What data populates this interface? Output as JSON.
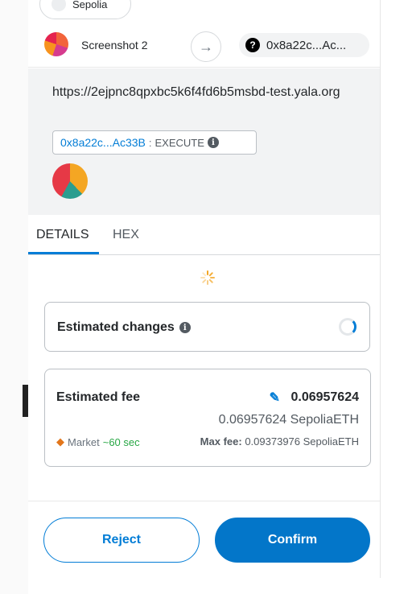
{
  "network": {
    "label": "Sepolia"
  },
  "header": {
    "from_account": "Screenshot 2",
    "to_address": "0x8a22c...Ac..."
  },
  "origin": {
    "url": "https://2ejpnc8qpxbc5k6f4fd6b5msbd-test.yala.org",
    "contract_address": "0x8a22c...Ac33B",
    "separator": ":",
    "method": "EXECUTE"
  },
  "tabs": [
    {
      "label": "DETAILS",
      "active": true
    },
    {
      "label": "HEX",
      "active": false
    }
  ],
  "estimated_changes": {
    "title": "Estimated changes"
  },
  "fee": {
    "title": "Estimated fee",
    "primary": "0.06957624",
    "secondary": "0.06957624 SepoliaETH",
    "market_label": "Market",
    "market_time": "~60 sec",
    "max_fee_label": "Max fee:",
    "max_fee_value": "0.09373976 SepoliaETH"
  },
  "buttons": {
    "reject": "Reject",
    "confirm": "Confirm"
  },
  "colors": {
    "accent": "#037dd6",
    "confirm_bg": "#0376c9",
    "success": "#28a745",
    "origin_bg": "#f2f3f4"
  },
  "icons": [
    "question-icon",
    "arrow-right-icon",
    "info-icon",
    "edit-icon",
    "fox-icon",
    "spinner-icon",
    "loader-icon"
  ]
}
